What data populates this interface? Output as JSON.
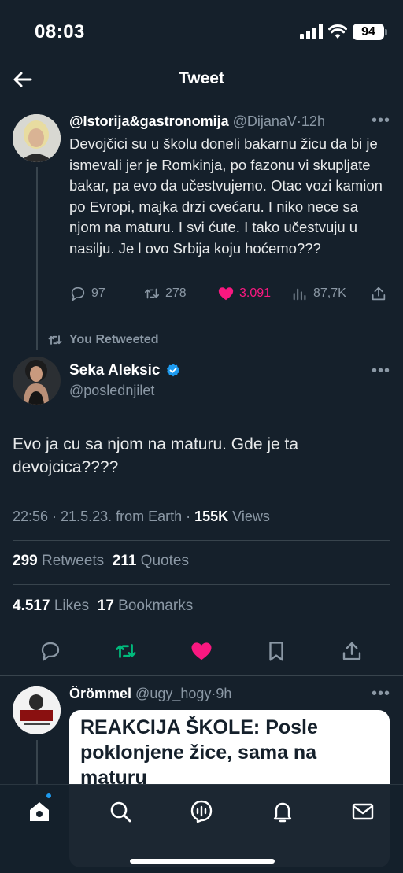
{
  "status_bar": {
    "time": "08:03",
    "battery": "94"
  },
  "header": {
    "title": "Tweet"
  },
  "quoted_tweet": {
    "author_name": "@Istorija&gastronomija",
    "handle": "@DijanaV",
    "age": "12h",
    "text": "Devojčici su u školu doneli bakarnu žicu da bi je ismevali jer je Romkinja, po fazonu vi skupljate bakar, pa evo da učestvujemo. Otac vozi kamion po Evropi, majka drzi cvećaru. I niko nece sa njom na maturu. I svi ćute. I tako učestvuju u nasilju. Je l ovo Srbija koju hoćemo???",
    "replies": "97",
    "retweets": "278",
    "likes": "3.091",
    "views": "87,7K"
  },
  "retweet_context": {
    "label": "You Retweeted"
  },
  "main_tweet": {
    "author_name": "Seka Aleksic",
    "handle": "@poslednjilet",
    "text": "Evo ja cu sa njom na maturu. Gde je ta devojcica????",
    "timestamp": "22:56 · 21.5.23. from Earth · ",
    "views_count": "155K",
    "views_label": " Views",
    "retweets_count": "299",
    "retweets_label": " Retweets",
    "quotes_count": "211",
    "quotes_label": " Quotes",
    "likes_count": "4.517",
    "likes_label": " Likes",
    "bookmarks_count": "17",
    "bookmarks_label": " Bookmarks"
  },
  "reply": {
    "author_name": "Örömmel",
    "handle": "@ugy_hogy",
    "age": "9h",
    "card_title": "REAKCIJA ŠKOLE: Posle poklonjene žice, sama na maturu"
  },
  "colors": {
    "accent": "#1d9bf0",
    "like": "#f91880",
    "retweet": "#00ba7c",
    "background": "#15202b"
  }
}
